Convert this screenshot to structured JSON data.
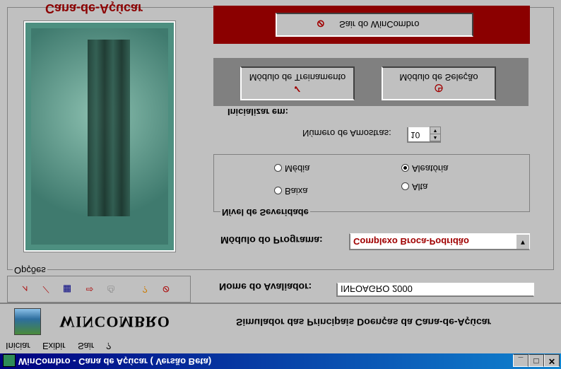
{
  "window": {
    "title": "WinCombro - Cana de Açúcar ( Versão Beta)",
    "controls": {
      "minimize": "_",
      "maximize": "□",
      "close": "✕"
    }
  },
  "menu": [
    "Iniciar",
    "Exibir",
    "Sair",
    "?"
  ],
  "banner": {
    "brand": "WINCOMBRO",
    "subtitle": "Simulador das Principais Doenças da Cana-de-Açúcar"
  },
  "toolbar": {
    "icons": [
      "chart-icon",
      "chart2-icon",
      "grid-icon",
      "export-icon",
      "print-icon",
      "help-icon",
      "exit-icon"
    ]
  },
  "avaliador": {
    "label": "Nome do Avaliador:",
    "value": "INFOAGRO 2000"
  },
  "opcoes": {
    "legend": "Opções"
  },
  "image_panel": {
    "caption": "Cana-de-Açúcar"
  },
  "modulo": {
    "label": "Módulo do Programa:",
    "selected": "Complexo Broca-Podridão"
  },
  "severidade": {
    "legend": "Nível de Severidade",
    "options": [
      {
        "label": "Baixa",
        "checked": false
      },
      {
        "label": "Alta",
        "checked": false
      },
      {
        "label": "Média",
        "checked": false
      },
      {
        "label": "Aleatória",
        "checked": true
      }
    ]
  },
  "amostras": {
    "label": "Número de Amostras:",
    "value": "10"
  },
  "inicializar": {
    "label": "Inicializar em:"
  },
  "modules": {
    "treinamento": "Módulo de Treinamento",
    "selecao": "Módulo de Seleção"
  },
  "sair": {
    "label": "Sair do WinCombro"
  }
}
